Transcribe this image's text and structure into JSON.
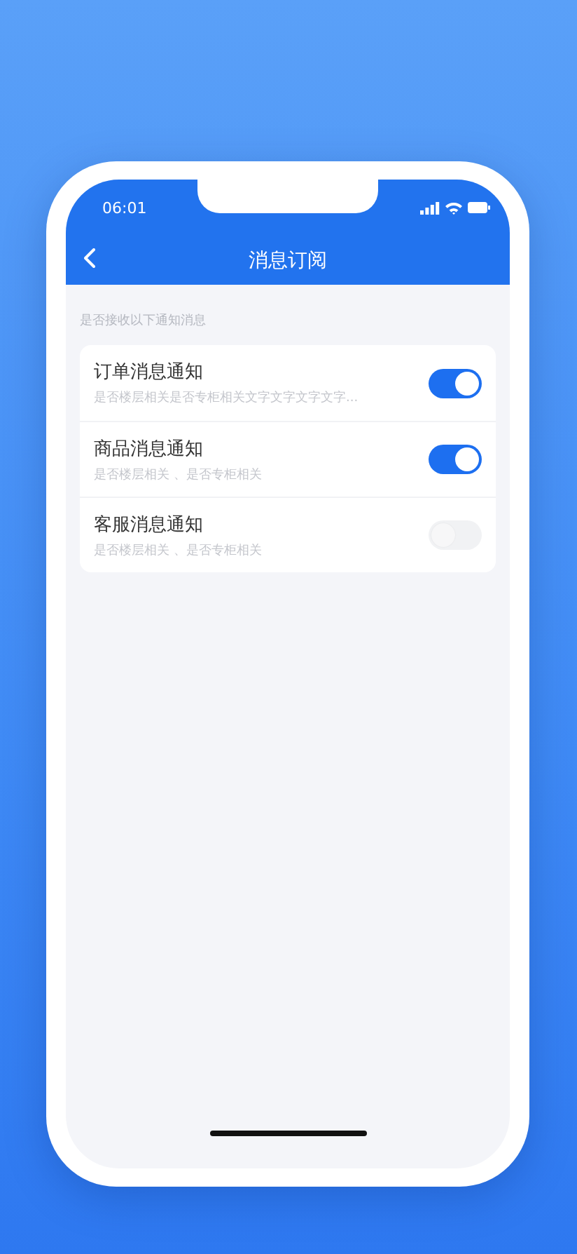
{
  "status_bar": {
    "time": "06:01"
  },
  "nav_bar": {
    "title": "消息订阅"
  },
  "section_label": "是否接收以下通知消息",
  "settings": [
    {
      "title": "订单消息通知",
      "subtitle": "是否楼层相关是否专柜相关文字文字文字文字...",
      "on": true
    },
    {
      "title": "商品消息通知",
      "subtitle": "是否楼层相关 、是否专柜相关",
      "on": true
    },
    {
      "title": "客服消息通知",
      "subtitle": "是否楼层相关 、是否专柜相关",
      "on": false
    }
  ]
}
